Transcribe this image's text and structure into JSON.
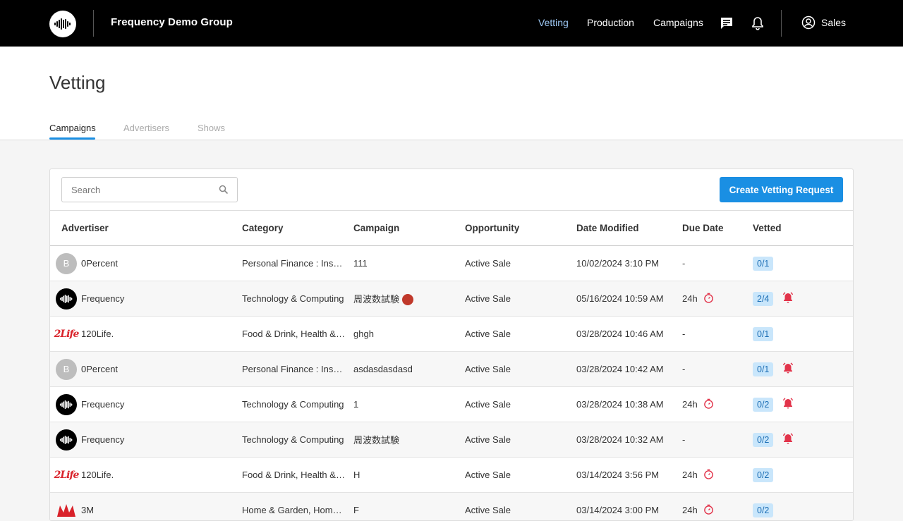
{
  "header": {
    "org_name": "Frequency Demo Group",
    "nav": [
      "Vetting",
      "Production",
      "Campaigns"
    ],
    "user": "Sales"
  },
  "page": {
    "title": "Vetting",
    "tabs": [
      "Campaigns",
      "Advertisers",
      "Shows"
    ]
  },
  "toolbar": {
    "search_placeholder": "Search",
    "create_label": "Create Vetting Request"
  },
  "table": {
    "columns": [
      "Advertiser",
      "Category",
      "Campaign",
      "Opportunity",
      "Date Modified",
      "Due Date",
      "Vetted"
    ],
    "rows": [
      {
        "avatar": "B",
        "advertiser": "0Percent",
        "category": "Personal Finance : Insurance",
        "campaign": "111",
        "opportunity": "Active Sale",
        "date": "10/02/2024 3:10 PM",
        "due": "-",
        "vetted": "0/1"
      },
      {
        "avatar": "",
        "advertiser": "Frequency",
        "category": "Technology & Computing",
        "campaign": "周波数試験",
        "opportunity": "Active Sale",
        "date": "05/16/2024 10:59 AM",
        "due": "24h",
        "vetted": "2/4"
      },
      {
        "avatar": "2Life",
        "advertiser": "120Life.",
        "category": "Food & Drink, Health & Fitness",
        "campaign": "ghgh",
        "opportunity": "Active Sale",
        "date": "03/28/2024 10:46 AM",
        "due": "-",
        "vetted": "0/1"
      },
      {
        "avatar": "B",
        "advertiser": "0Percent",
        "category": "Personal Finance : Insurance",
        "campaign": "asdasdasdasd",
        "opportunity": "Active Sale",
        "date": "03/28/2024 10:42 AM",
        "due": "-",
        "vetted": "0/1"
      },
      {
        "avatar": "",
        "advertiser": "Frequency",
        "category": "Technology & Computing",
        "campaign": "1",
        "opportunity": "Active Sale",
        "date": "03/28/2024 10:38 AM",
        "due": "24h",
        "vetted": "0/2"
      },
      {
        "avatar": "",
        "advertiser": "Frequency",
        "category": "Technology & Computing",
        "campaign": "周波数試験",
        "opportunity": "Active Sale",
        "date": "03/28/2024 10:32 AM",
        "due": "-",
        "vetted": "0/2"
      },
      {
        "avatar": "2Life",
        "advertiser": "120Life.",
        "category": "Food & Drink, Health & Fitness",
        "campaign": "H",
        "opportunity": "Active Sale",
        "date": "03/14/2024 3:56 PM",
        "due": "24h",
        "vetted": "0/2"
      },
      {
        "avatar": "",
        "advertiser": "3M",
        "category": "Home & Garden, Home Improvement",
        "campaign": "F",
        "opportunity": "Active Sale",
        "date": "03/14/2024 3:00 PM",
        "due": "24h",
        "vetted": "0/2"
      }
    ]
  },
  "colors": {
    "accent": "#1a8fe3",
    "nav_active": "#9ec9f5",
    "alert": "#e2334a",
    "badge_bg": "#c9e6fb"
  }
}
